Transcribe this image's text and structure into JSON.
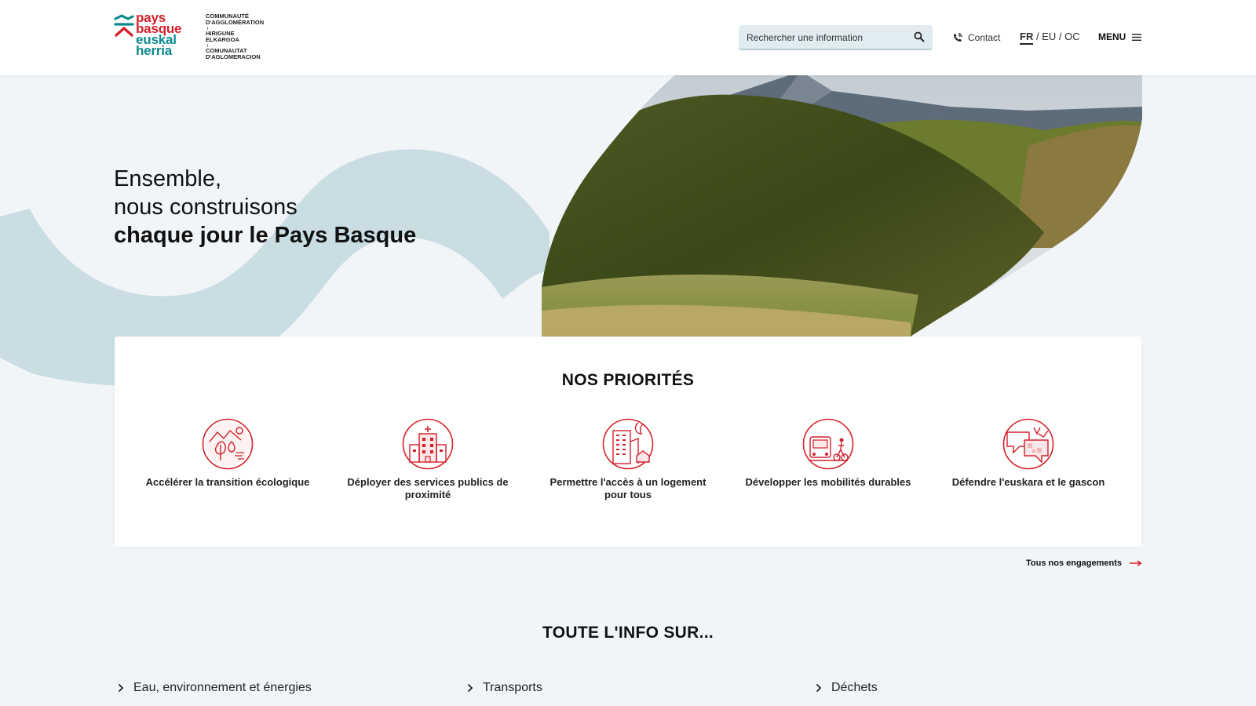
{
  "header": {
    "logo": {
      "words": [
        "pays",
        "basque",
        "euskal",
        "herria"
      ],
      "side_lines": [
        "COMMUNAUTÉ",
        "D'AGGLOMÉRATION",
        "HIRIGUNE",
        "ELKARGOA",
        "COMUNAUTAT",
        "D'AGLOMERACION"
      ]
    },
    "search": {
      "placeholder": "Rechercher une information",
      "icon": "search-icon"
    },
    "contact_label": "Contact",
    "languages": {
      "active": "FR",
      "others": "/ EU / OC"
    },
    "menu_label": "MENU"
  },
  "hero": {
    "line1": "Ensemble,",
    "line2": "nous construisons",
    "line3": "chaque jour le Pays Basque"
  },
  "priorities": {
    "title": "NOS PRIORITÉS",
    "items": [
      {
        "label": "Accélérer la transition écologique",
        "icon": "ecology-icon"
      },
      {
        "label": "Déployer des services publics de proximité",
        "icon": "public-services-icon"
      },
      {
        "label": "Permettre l'accès à un logement pour tous",
        "icon": "housing-icon"
      },
      {
        "label": "Développer les mobilités durables",
        "icon": "mobility-icon"
      },
      {
        "label": "Défendre l'euskara et le gascon",
        "icon": "languages-icon"
      }
    ],
    "all_link": "Tous nos engagements"
  },
  "info": {
    "title": "TOUTE L'INFO SUR...",
    "items": [
      "Eau, environnement et énergies",
      "Transports",
      "Déchets"
    ]
  },
  "colors": {
    "brand_red": "#d4202a",
    "brand_teal": "#0c8a8f",
    "wave": "#c9dde2",
    "bg": "#f1f5f8"
  }
}
